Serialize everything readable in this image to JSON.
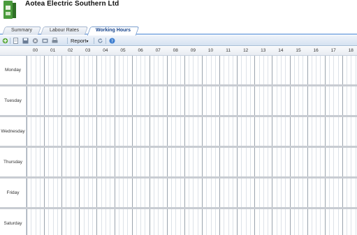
{
  "company": {
    "name": "Aotea Electric Southern Ltd"
  },
  "tabs": [
    {
      "label": "Summary",
      "active": false
    },
    {
      "label": "Labour Rates",
      "active": false
    },
    {
      "label": "Working Hours",
      "active": true
    }
  ],
  "toolbar": {
    "report_label": "Report",
    "icons": [
      "add-icon",
      "document-icon",
      "save-icon",
      "delete-icon",
      "export-icon",
      "print-icon",
      "refresh-icon",
      "help-icon"
    ]
  },
  "hours": [
    "00",
    "01",
    "02",
    "03",
    "04",
    "05",
    "06",
    "07",
    "08",
    "09",
    "10",
    "11",
    "12",
    "13",
    "14",
    "15",
    "16",
    "17",
    "18"
  ],
  "days": [
    "Monday",
    "Tuesday",
    "Wednesday",
    "Thursday",
    "Friday",
    "Saturday"
  ],
  "colors": {
    "accent": "#15428b",
    "tab_border": "#99bbe8",
    "grid_major": "#9aa3ad",
    "grid_minor": "#dde2e8"
  }
}
